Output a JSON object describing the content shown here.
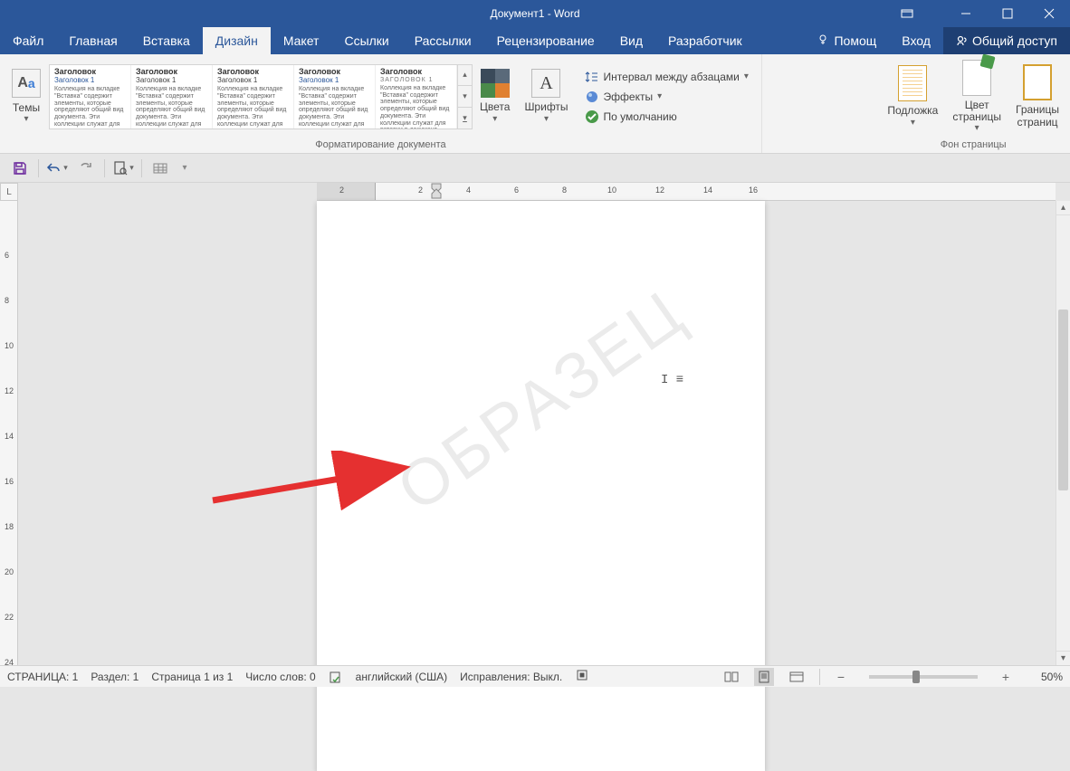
{
  "titlebar": {
    "title": "Документ1 - Word"
  },
  "tabs": {
    "file": "Файл",
    "home": "Главная",
    "insert": "Вставка",
    "design": "Дизайн",
    "layout": "Макет",
    "references": "Ссылки",
    "mailings": "Рассылки",
    "review": "Рецензирование",
    "view": "Вид",
    "developer": "Разработчик",
    "tell_me": "Помощ",
    "sign_in": "Вход",
    "share": "Общий доступ"
  },
  "ribbon": {
    "themes": {
      "label": "Темы"
    },
    "formatting_group": "Форматирование документа",
    "page_bg_group": "Фон страницы",
    "gallery": {
      "heading": "Заголовок",
      "thumbs": [
        {
          "h2": "Заголовок 1"
        },
        {
          "h2": "Заголовок 1"
        },
        {
          "h2": "Заголовок 1"
        },
        {
          "h2": "Заголовок 1"
        },
        {
          "h2": "ЗАГОЛОВОК 1"
        }
      ]
    },
    "colors": "Цвета",
    "fonts": "Шрифты",
    "paragraph_spacing": "Интервал между абзацами",
    "effects": "Эффекты",
    "set_default": "По умолчанию",
    "watermark": "Подложка",
    "page_color": "Цвет\nстраницы",
    "page_borders": "Границы\nстраниц"
  },
  "ruler": {
    "h": [
      "2",
      "2",
      "4",
      "6",
      "8",
      "10",
      "12",
      "14",
      "16"
    ],
    "v": [
      "6",
      "8",
      "10",
      "12",
      "14",
      "16",
      "18",
      "20",
      "22",
      "24"
    ]
  },
  "page": {
    "watermark": "ОБРАЗЕЦ"
  },
  "status": {
    "page": "СТРАНИЦА: 1",
    "section": "Раздел: 1",
    "page_of": "Страница 1 из 1",
    "words": "Число слов: 0",
    "language": "английский (США)",
    "track_changes": "Исправления: Выкл.",
    "zoom": "50%"
  }
}
